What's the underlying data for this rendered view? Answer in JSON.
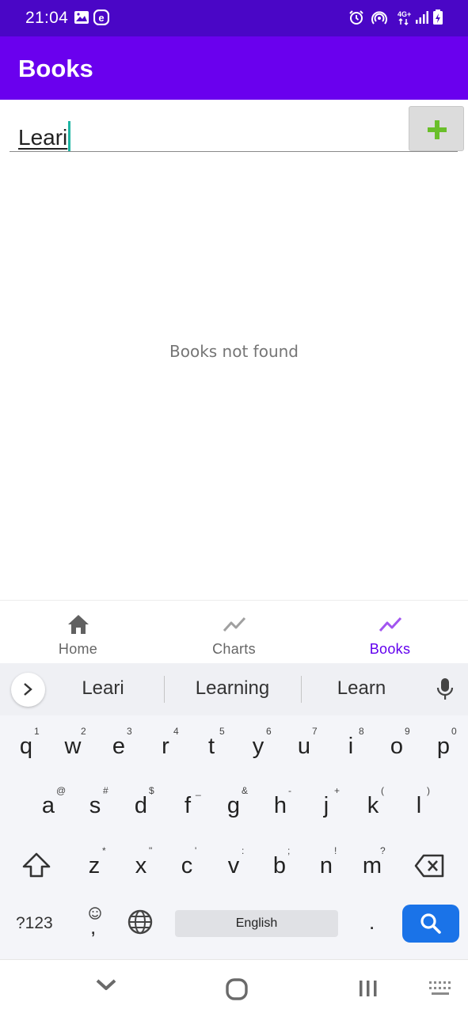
{
  "status_bar": {
    "time": "21:04",
    "left_icons": [
      "image-icon",
      "e-notification-icon"
    ],
    "right_icons": [
      "alarm-icon",
      "hotspot-icon",
      "network-4g-icon",
      "signal-icon",
      "battery-icon"
    ],
    "network_label": "4G+",
    "background": "#4a06c6"
  },
  "app_bar": {
    "title": "Books",
    "background": "#6a00ee"
  },
  "search": {
    "value": "Leari",
    "add_icon": "plus-icon",
    "add_icon_color": "#6abf2a"
  },
  "content": {
    "empty_message": "Books not found"
  },
  "bottom_nav": {
    "active_color": "#6200ee",
    "inactive_color": "#666666",
    "items": [
      {
        "label": "Home",
        "icon": "home-icon",
        "active": false
      },
      {
        "label": "Charts",
        "icon": "chart-line-icon",
        "active": false
      },
      {
        "label": "Books",
        "icon": "chart-line-icon",
        "active": true
      }
    ]
  },
  "keyboard": {
    "suggestions": [
      "Leari",
      "Learning",
      "Learn"
    ],
    "rows": [
      [
        {
          "c": "q",
          "h": "1"
        },
        {
          "c": "w",
          "h": "2"
        },
        {
          "c": "e",
          "h": "3"
        },
        {
          "c": "r",
          "h": "4"
        },
        {
          "c": "t",
          "h": "5"
        },
        {
          "c": "y",
          "h": "6"
        },
        {
          "c": "u",
          "h": "7"
        },
        {
          "c": "i",
          "h": "8"
        },
        {
          "c": "o",
          "h": "9"
        },
        {
          "c": "p",
          "h": "0"
        }
      ],
      [
        {
          "c": "a",
          "h": "@"
        },
        {
          "c": "s",
          "h": "#"
        },
        {
          "c": "d",
          "h": "$"
        },
        {
          "c": "f",
          "h": "_"
        },
        {
          "c": "g",
          "h": "&"
        },
        {
          "c": "h",
          "h": "-"
        },
        {
          "c": "j",
          "h": "+"
        },
        {
          "c": "k",
          "h": "("
        },
        {
          "c": "l",
          "h": ")"
        }
      ],
      [
        {
          "c": "z",
          "h": "*"
        },
        {
          "c": "x",
          "h": "\""
        },
        {
          "c": "c",
          "h": "'"
        },
        {
          "c": "v",
          "h": ":"
        },
        {
          "c": "b",
          "h": ";"
        },
        {
          "c": "n",
          "h": "!"
        },
        {
          "c": "m",
          "h": "?"
        }
      ]
    ],
    "symbols_key": "?123",
    "emoji_key": ",",
    "space_label": "English",
    "period_key": ".",
    "action_color": "#1a73e8"
  },
  "system_nav": {
    "icons": [
      "hide-keyboard-icon",
      "home-circle-icon",
      "recents-icon",
      "keyboard-icon"
    ]
  }
}
